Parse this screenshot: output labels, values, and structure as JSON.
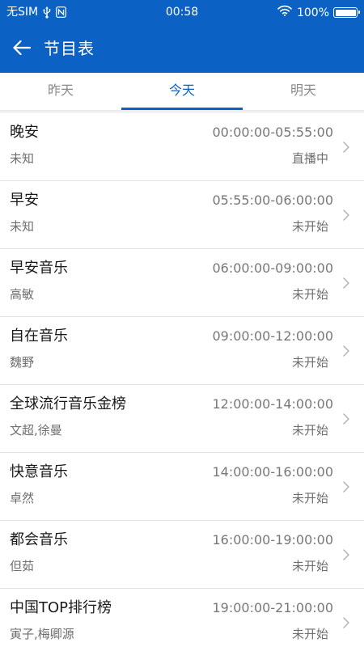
{
  "status_bar": {
    "carrier": "无SIM",
    "time": "00:58",
    "battery": "100%"
  },
  "app_bar": {
    "title": "节目表"
  },
  "tabs": [
    {
      "label": "昨天",
      "active": false
    },
    {
      "label": "今天",
      "active": true
    },
    {
      "label": "明天",
      "active": false
    }
  ],
  "programs": [
    {
      "name": "晚安",
      "host": "未知",
      "time": "00:00:00-05:55:00",
      "status": "直播中"
    },
    {
      "name": "早安",
      "host": "未知",
      "time": "05:55:00-06:00:00",
      "status": "未开始"
    },
    {
      "name": "早安音乐",
      "host": "高敏",
      "time": "06:00:00-09:00:00",
      "status": "未开始"
    },
    {
      "name": "自在音乐",
      "host": "魏野",
      "time": "09:00:00-12:00:00",
      "status": "未开始"
    },
    {
      "name": "全球流行音乐金榜",
      "host": "文超,徐曼",
      "time": "12:00:00-14:00:00",
      "status": "未开始"
    },
    {
      "name": "快意音乐",
      "host": "卓然",
      "time": "14:00:00-16:00:00",
      "status": "未开始"
    },
    {
      "name": "都会音乐",
      "host": "但茹",
      "time": "16:00:00-19:00:00",
      "status": "未开始"
    },
    {
      "name": "中国TOP排行榜",
      "host": "寅子,梅卿源",
      "time": "19:00:00-21:00:00",
      "status": "未开始"
    }
  ],
  "colors": {
    "primary": "#0b62c4",
    "divider": "#e2e2e2",
    "text_primary": "#1a1a1a",
    "text_secondary": "#6e6e6e"
  },
  "icons": {
    "back": "arrow-left-icon",
    "row_action": "chevron-right-icon",
    "status": [
      "usb-icon",
      "nfc-icon",
      "wifi-icon",
      "battery-icon"
    ]
  }
}
